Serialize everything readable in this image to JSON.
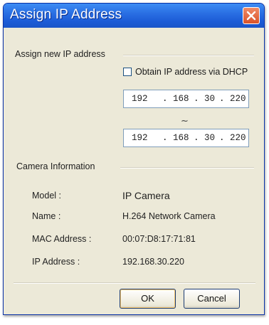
{
  "window": {
    "title": "Assign IP Address",
    "close_icon": "close-icon",
    "close_color": "#d9532a"
  },
  "assign": {
    "group_label": "Assign new IP address",
    "dhcp_label": "Obtain IP address via DHCP",
    "dhcp_checked": false,
    "range_separator": "~",
    "ip_from": [
      "192",
      ". 168",
      ". 30",
      ". 220"
    ],
    "ip_to": [
      "192",
      ". 168",
      ". 30",
      ". 220"
    ]
  },
  "camera": {
    "group_label": "Camera Information",
    "model_label": "Model :",
    "model_value": "IP Camera",
    "name_label": "Name :",
    "name_value": "H.264 Network Camera",
    "mac_label": "MAC Address :",
    "mac_value": "00:07:D8:17:71:81",
    "ip_label": "IP Address :",
    "ip_value": "192.168.30.220"
  },
  "buttons": {
    "ok": "OK",
    "cancel": "Cancel"
  },
  "colors": {
    "titlebar": "#1c5bd6",
    "window_bg": "#ece9d8"
  }
}
